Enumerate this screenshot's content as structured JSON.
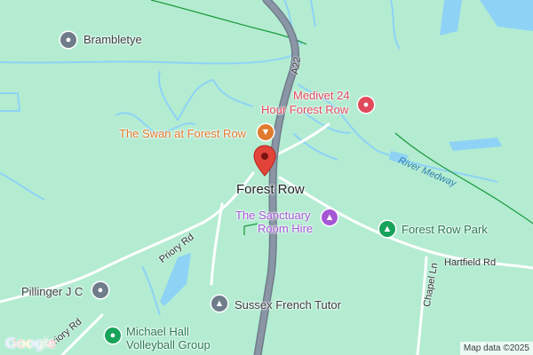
{
  "map": {
    "place_title": "Forest Row",
    "colors": {
      "land": "#b4ecd2",
      "water": "#8ed3f5",
      "road": "#ffffff",
      "highway": "#8a96a6",
      "boundary": "#1a9a3a",
      "poi_gray": "#6f7c8a",
      "poi_food": "#e07a2c",
      "poi_health": "#e04a5b",
      "poi_purple": "#a557d6",
      "poi_green": "#17a35a",
      "marker": "#e2443a"
    },
    "roads": {
      "a22": "A22",
      "priory_rd_1": "Priory Rd",
      "priory_rd_2": "Priory Rd",
      "hartfield_rd": "Hartfield Rd",
      "chapel_ln": "Chapel Ln"
    },
    "water": {
      "river_medway": "River Medway"
    },
    "pois": {
      "brambletye": {
        "label": "Brambletye",
        "icon": "landmark-icon"
      },
      "medivet": {
        "line1": "Medivet 24",
        "line2": "Hour Forest Row",
        "icon": "vet-icon"
      },
      "swan": {
        "label": "The Swan at Forest Row",
        "icon": "cocktail-icon"
      },
      "sanctuary": {
        "line1": "The Sanctuary",
        "line2": "Room Hire",
        "icon": "venue-icon"
      },
      "forest_row_park": {
        "label": "Forest Row Park",
        "icon": "park-icon"
      },
      "pillinger": {
        "label": "Pillinger J C",
        "icon": "landmark-icon"
      },
      "sussex_french": {
        "label": "Sussex French Tutor",
        "icon": "school-icon"
      },
      "michael_hall": {
        "line1": "Michael Hall",
        "line2": "Volleyball Group",
        "icon": "sports-icon"
      }
    },
    "logo": "Google",
    "attribution": "Map data ©2025"
  }
}
